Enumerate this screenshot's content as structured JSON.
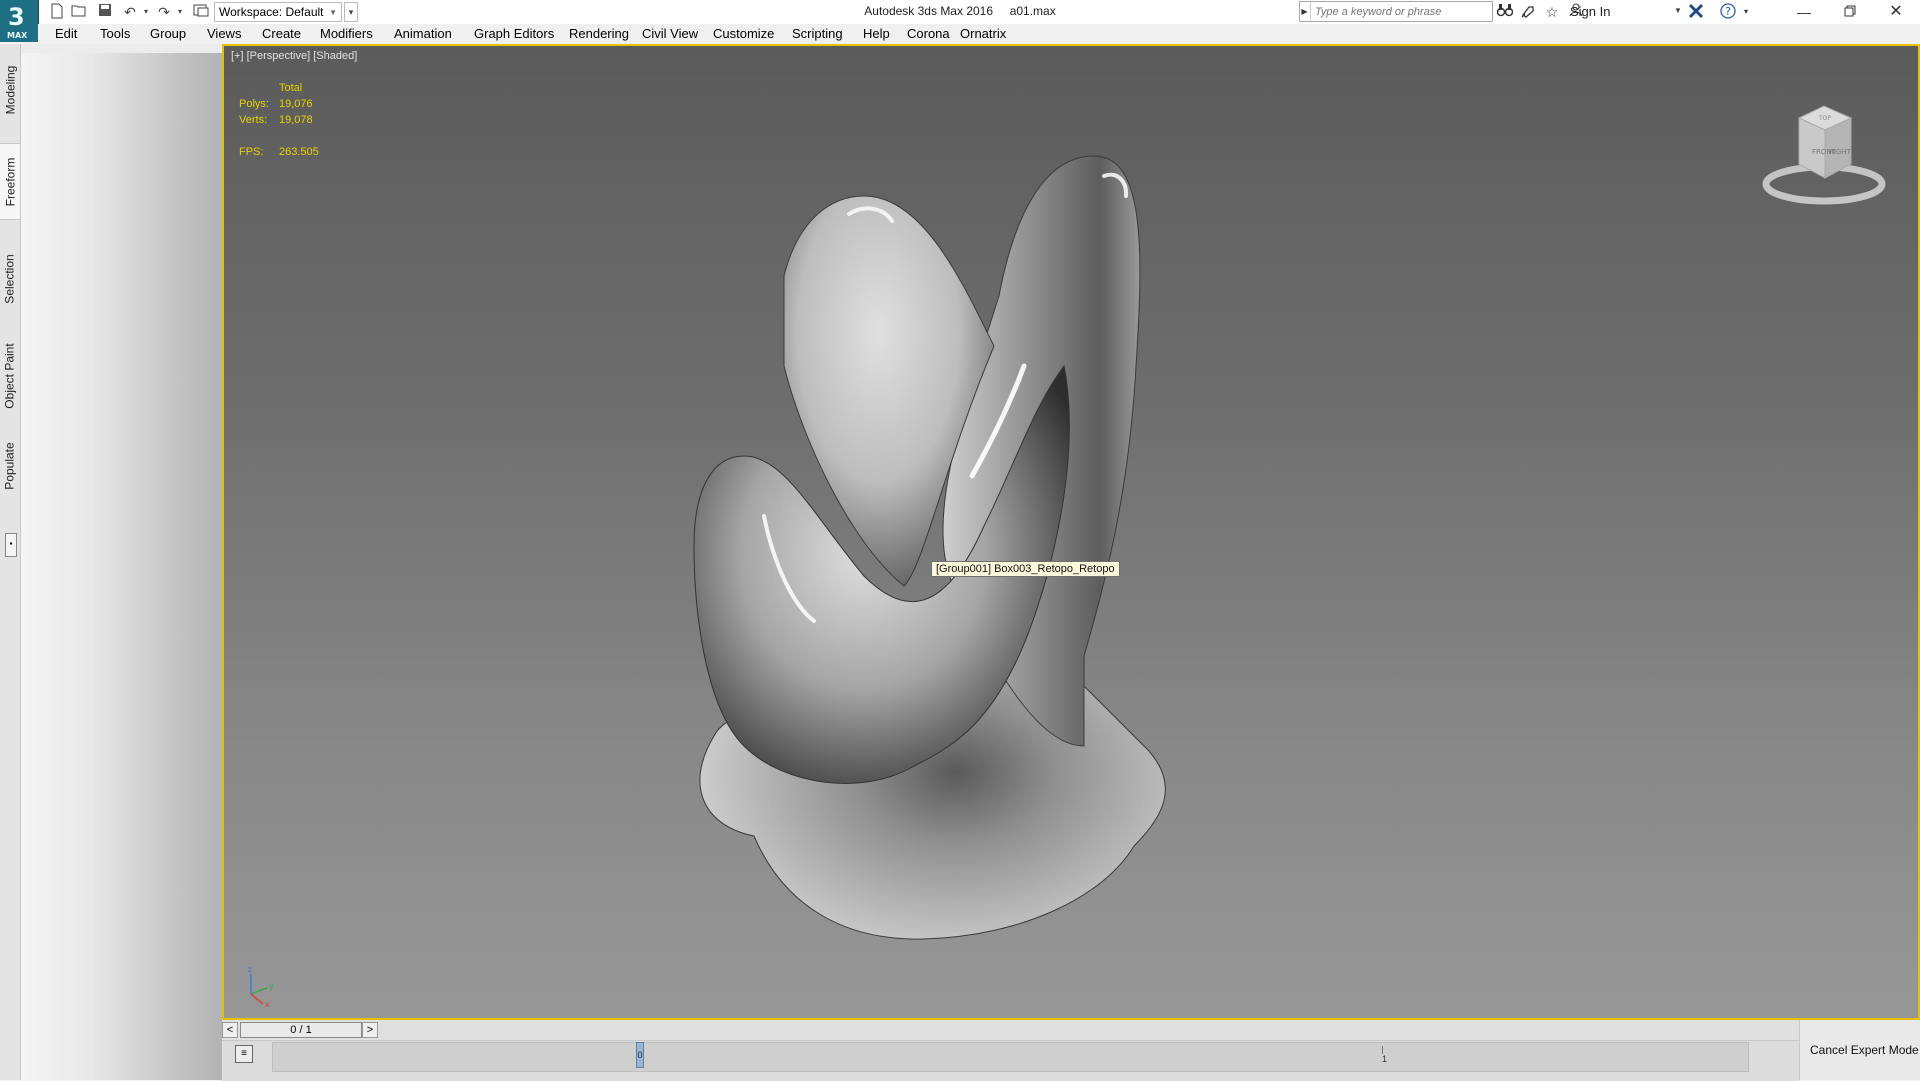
{
  "app": {
    "title": "Autodesk 3ds Max 2016",
    "file": "a01.max",
    "logo_text": "MAX",
    "logo_letter": "3"
  },
  "quick_access": {
    "icons": [
      "new-file-icon",
      "open-file-icon",
      "save-icon",
      "undo-icon",
      "redo-icon",
      "project-folder-icon"
    ],
    "workspace_label": "Workspace: Default"
  },
  "infocenter": {
    "search_placeholder": "Type a keyword or phrase",
    "sign_in": "Sign In"
  },
  "menu": {
    "items": [
      "Edit",
      "Tools",
      "Group",
      "Views",
      "Create",
      "Modifiers",
      "Animation",
      "Graph Editors",
      "Rendering",
      "Civil View",
      "Customize",
      "Scripting",
      "Help",
      "Corona",
      "Ornatrix"
    ]
  },
  "ribbon_tabs": [
    "Modeling",
    "Freeform",
    "Selection",
    "Object Paint",
    "Populate"
  ],
  "viewport": {
    "label": "[+] [Perspective] [Shaded]",
    "stats": {
      "header": "Total",
      "polys_label": "Polys:",
      "polys_value": "19,076",
      "verts_label": "Verts:",
      "verts_value": "19,078",
      "fps_label": "FPS:",
      "fps_value": "263.505"
    },
    "tooltip": "[Group001] Box003_Retopo_Retopo",
    "viewcube_faces": [
      "FRONT",
      "RIGHT",
      "TOP"
    ],
    "gizmo_axes": [
      "x",
      "y",
      "z"
    ]
  },
  "timeline": {
    "frame_display": "0 / 1",
    "prev": "<",
    "next": ">",
    "key_frame": "0",
    "tick_label": "1"
  },
  "expert_mode": {
    "cancel_label": "Cancel Expert Mode"
  },
  "colors": {
    "viewport_border": "#e6c100",
    "stats_text": "#e8d100",
    "tooltip_bg": "#fff8dc"
  }
}
